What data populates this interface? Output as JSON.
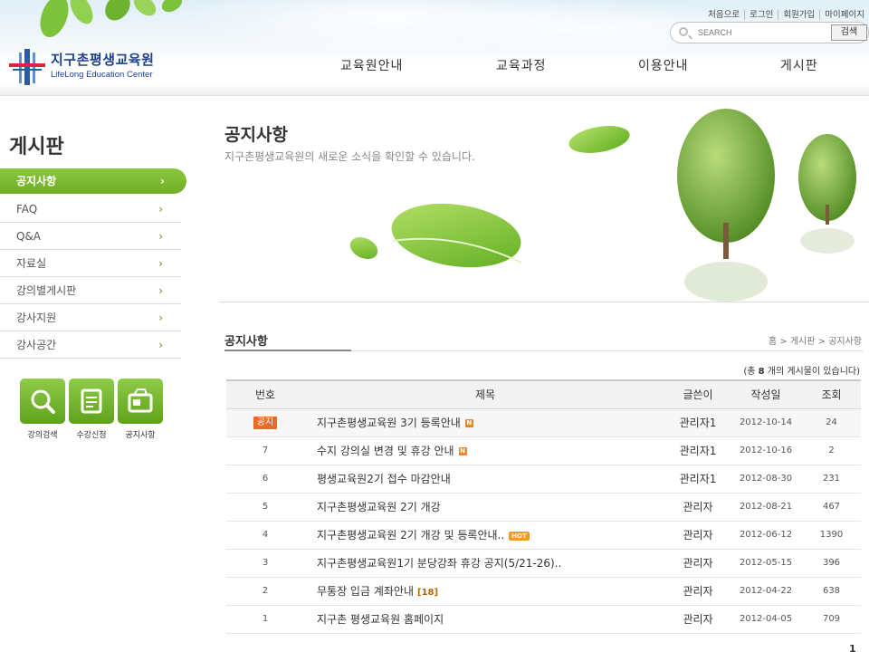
{
  "header": {
    "logo_title": "지구촌평생교육원",
    "logo_sub": "LifeLong Education Center",
    "util_links": [
      "처음으로",
      "로그인",
      "회원가입",
      "마이페이지"
    ],
    "search": {
      "placeholder": "SEARCH",
      "button": "검색"
    },
    "gnb": [
      "교육원안내",
      "교육과정",
      "이용안내",
      "게시판"
    ]
  },
  "sidebar": {
    "title": "게시판",
    "items": [
      {
        "label": "공지사항",
        "active": true
      },
      {
        "label": "FAQ"
      },
      {
        "label": "Q&A"
      },
      {
        "label": "자료실"
      },
      {
        "label": "강의별게시판"
      },
      {
        "label": "강사지원"
      },
      {
        "label": "강사공간"
      }
    ],
    "chevron": "›",
    "quick": [
      {
        "label": "강의검색",
        "icon": "magnifier-icon"
      },
      {
        "label": "수강신청",
        "icon": "document-icon"
      },
      {
        "label": "공지사항",
        "icon": "notice-icon"
      }
    ]
  },
  "visual": {
    "title": "공지사항",
    "subtitle": "지구촌평생교육원의 새로운 소식을 확인할 수 있습니다."
  },
  "content": {
    "title": "공지사항",
    "breadcrumb": "홈 > 게시판 > 공지사항",
    "count_prefix": "(총 ",
    "count": "8",
    "count_suffix": " 개의 게시물이 있습니다)",
    "columns": [
      "번호",
      "제목",
      "글쓴이",
      "작성일",
      "조회"
    ],
    "rows": [
      {
        "no": "공지",
        "title": "지구촌평생교육원 3기 등록안내",
        "badge": "N",
        "author": "관리자1",
        "date": "2012-10-14",
        "views": "24"
      },
      {
        "no": "7",
        "title": "수지 강의실 변경 및 휴강 안내",
        "badge": "N",
        "author": "관리자1",
        "date": "2012-10-16",
        "views": "2"
      },
      {
        "no": "6",
        "title": "평생교육원2기 접수 마감안내",
        "author": "관리자1",
        "date": "2012-08-30",
        "views": "231"
      },
      {
        "no": "5",
        "title": "지구촌평생교육원 2기 개강",
        "author": "관리자",
        "date": "2012-08-21",
        "views": "467"
      },
      {
        "no": "4",
        "title": "지구촌평생교육원 2기 개강 및 등록안내..",
        "hot": "HOT",
        "author": "관리자",
        "date": "2012-06-12",
        "views": "1390"
      },
      {
        "no": "3",
        "title": "지구촌평생교육원1기 분당강좌 휴강 공지(5/21-26)..",
        "author": "관리자",
        "date": "2012-05-15",
        "views": "396"
      },
      {
        "no": "2",
        "title": "무통장 입금 계좌안내",
        "comments": "[18]",
        "author": "관리자",
        "date": "2012-04-22",
        "views": "638"
      },
      {
        "no": "1",
        "title": "지구촌 평생교육원 홈페이지",
        "author": "관리자",
        "date": "2012-04-05",
        "views": "709"
      }
    ],
    "page": "1"
  }
}
